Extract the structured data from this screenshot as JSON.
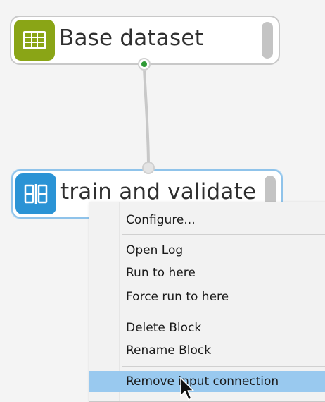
{
  "workflow": {
    "blocks": [
      {
        "title": "Base dataset",
        "icon": "table-icon",
        "icon_color": "#8aa516"
      },
      {
        "title": "train and validate",
        "icon": "split-icon",
        "icon_color": "#2a93d5"
      }
    ],
    "connection_color": "#c8c8c8",
    "output_port_color": "#2f9a36"
  },
  "context_menu": {
    "items": [
      {
        "label": "Configure..."
      },
      {
        "label": "Open Log"
      },
      {
        "label": "Run to here"
      },
      {
        "label": "Force run to here"
      },
      {
        "label": "Delete Block"
      },
      {
        "label": "Rename Block"
      },
      {
        "label": "Remove input connection"
      }
    ],
    "highlight_color": "#99c9ef"
  }
}
